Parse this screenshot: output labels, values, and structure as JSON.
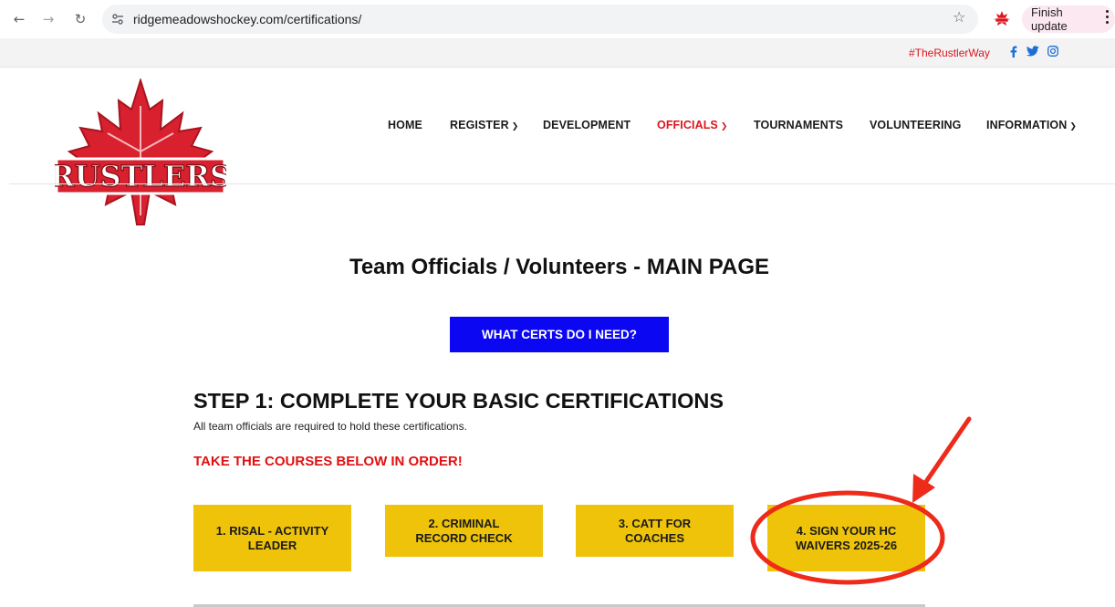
{
  "browser": {
    "url": "ridgemeadowshockey.com/certifications/",
    "finish_update_label": "Finish update"
  },
  "topbar": {
    "hashtag": "#TheRustlerWay",
    "social_icons": [
      "facebook-icon",
      "twitter-icon",
      "instagram-icon"
    ]
  },
  "logo": {
    "text": "RUSTLERS"
  },
  "nav": {
    "items": [
      {
        "label": "HOME",
        "dropdown": false
      },
      {
        "label": "REGISTER",
        "dropdown": true
      },
      {
        "label": "DEVELOPMENT",
        "dropdown": false
      },
      {
        "label": "OFFICIALS",
        "dropdown": true,
        "active": true
      },
      {
        "label": "TOURNAMENTS",
        "dropdown": false
      },
      {
        "label": "VOLUNTEERING",
        "dropdown": false
      },
      {
        "label": "INFORMATION",
        "dropdown": true
      }
    ]
  },
  "main": {
    "title": "Team Officials / Volunteers - MAIN PAGE",
    "cta_label": "WHAT CERTS DO I NEED?",
    "step1": {
      "title": "STEP 1: COMPLETE YOUR BASIC CERTIFICATIONS",
      "subtitle": "All team officials are required to hold these certifications.",
      "warning": "TAKE THE COURSES BELOW IN ORDER!",
      "courses": [
        {
          "label": "1. RISAL - ACTIVITY LEADER"
        },
        {
          "label": "2. CRIMINAL RECORD CHECK"
        },
        {
          "label": "3. CATT FOR COACHES"
        },
        {
          "label": "4. SIGN YOUR HC WAIVERS 2025-26"
        }
      ]
    }
  },
  "colors": {
    "accent_red": "#d9151e",
    "cta_blue": "#0b07f2",
    "course_yellow": "#eec30a",
    "annotation_red": "#ee2a1a"
  }
}
